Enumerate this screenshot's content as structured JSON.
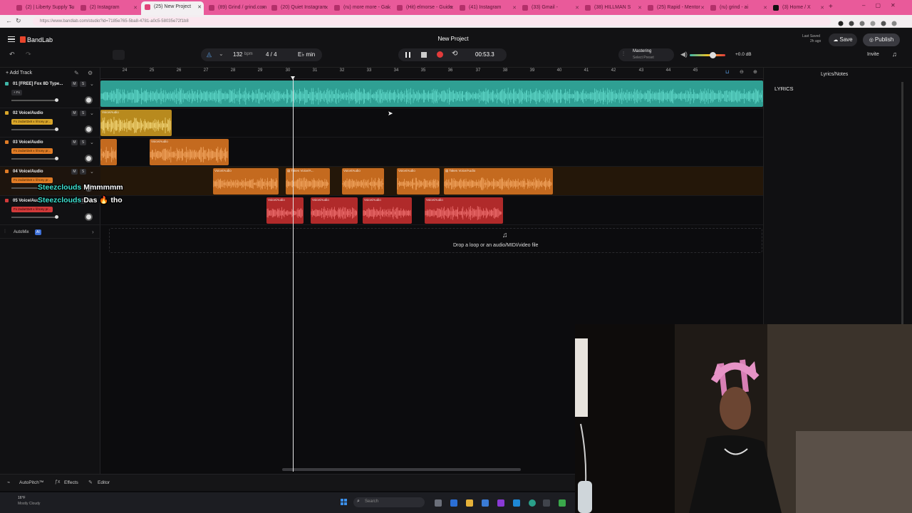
{
  "browser": {
    "tabs": [
      {
        "label": "(2) | Liberty Supply Tu"
      },
      {
        "label": "(2) Instagram"
      },
      {
        "label": "(25) New Project",
        "active": true
      },
      {
        "label": "(89) Grind / grind.com"
      },
      {
        "label": "(20) Quiet Instagram"
      },
      {
        "label": "(ru) more more - Gal"
      },
      {
        "label": "(Hit) elmorse - Guide"
      },
      {
        "label": "(41) Instagram"
      },
      {
        "label": "(33) Gmail -"
      },
      {
        "label": "(38) HILLMAN S"
      },
      {
        "label": "(25) Rapid - Mentor"
      },
      {
        "label": "(ru) grind - ai"
      },
      {
        "label": "(3) Home / X"
      }
    ],
    "url": "https://www.bandlab.com/studio?id=7185e765-5ba8-4781-a0c5-58035e72f1b8"
  },
  "app": {
    "logo": "BandLab",
    "project_title": "New Project",
    "bpm": "132",
    "bpm_unit": "bpm",
    "time_sig": "4 / 4",
    "key": "E♭ min",
    "time": "00:53.3",
    "mastering_label": "Mastering",
    "mastering_sub": "Select Preset",
    "volume_db": "+0.0 dB",
    "last_saved_label": "Last Saved",
    "last_saved_value": "2h ago",
    "save_label": "Save",
    "publish_label": "Publish",
    "invite_label": "Invite",
    "add_track_label": "Add Track",
    "lyrics_panel_title": "Lyrics/Notes",
    "lyrics_label": "LYRICS",
    "drop_hint": "Drop a loop or an audio/MIDI/video file",
    "automix_label": "AutoMix",
    "automix_badge": "AI"
  },
  "ruler": [
    "24",
    "25",
    "26",
    "27",
    "28",
    "29",
    "30",
    "31",
    "32",
    "33",
    "34",
    "35",
    "36",
    "37",
    "38",
    "39",
    "40",
    "41",
    "42",
    "43",
    "44",
    "45"
  ],
  "tracks": [
    {
      "name": "01 [FREE] Fox 8D Type...",
      "fx": "+ Fx",
      "color": "#3fb6a8"
    },
    {
      "name": "02 Voice/Audio",
      "fx": "Fx 2xdart3x8 x lil tony pr...",
      "color": "#d9a62a"
    },
    {
      "name": "03 Voice/Audio",
      "fx": "Fx 2xdart3x8 x lil tony pr...",
      "color": "#e07c26"
    },
    {
      "name": "04 Voice/Audio",
      "fx": "Fx 2xdart3x8 x lil tony pr...",
      "color": "#e07c26"
    },
    {
      "name": "05 Voice/Audio",
      "fx": "Fx 2xdart3x8 x lil tony pr...",
      "color": "#d23a3a"
    }
  ],
  "track_buttons": {
    "m": "M",
    "s": "S"
  },
  "clip_labels": {
    "voice": "Voice/Audio",
    "takes": "Takes",
    "voice_short": "Voice/A..."
  },
  "captions": [
    {
      "user": "Steezclouds",
      "text": "Mmmmmm"
    },
    {
      "user": "Steezclouds",
      "text": "Das 🔥 tho"
    }
  ],
  "bottom": {
    "autopitch": "AutoPitch™",
    "effects": "Effects",
    "editor": "Editor"
  },
  "taskbar": {
    "weather_temp": "16°F",
    "weather_desc": "Mostly Cloudy",
    "search": "Search"
  },
  "colors": {
    "teal": "#3fb6a8",
    "yellow": "#d9a62a",
    "orange": "#e07c26",
    "red": "#d23a3a",
    "tabbar": "#e95a9a"
  }
}
